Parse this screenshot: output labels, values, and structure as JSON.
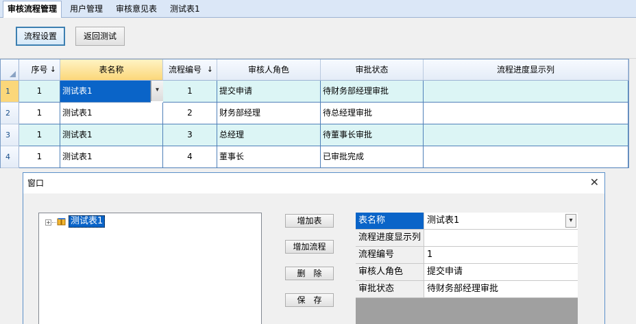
{
  "tabs": [
    {
      "label": "审核流程管理"
    },
    {
      "label": "用户管理"
    },
    {
      "label": "审核意见表"
    },
    {
      "label": "测试表1"
    }
  ],
  "toolbar": {
    "flow_settings_label": "流程设置",
    "back_test_label": "返回测试"
  },
  "grid": {
    "columns": [
      "序号",
      "表名称",
      "流程编号",
      "审核人角色",
      "审批状态",
      "流程进度显示列"
    ],
    "sort_glyph": "↓",
    "rows": [
      {
        "rownum": "1",
        "seq": "1",
        "table": "测试表1",
        "flow_no": "1",
        "role": "提交申请",
        "status": "待财务部经理审批",
        "progress": ""
      },
      {
        "rownum": "2",
        "seq": "1",
        "table": "测试表1",
        "flow_no": "2",
        "role": "财务部经理",
        "status": "待总经理审批",
        "progress": ""
      },
      {
        "rownum": "3",
        "seq": "1",
        "table": "测试表1",
        "flow_no": "3",
        "role": "总经理",
        "status": "待董事长审批",
        "progress": ""
      },
      {
        "rownum": "4",
        "seq": "1",
        "table": "测试表1",
        "flow_no": "4",
        "role": "董事长",
        "status": "已审批完成",
        "progress": ""
      }
    ],
    "row_colors": {
      "alt": "#dcf5f5",
      "plain": "#ffffff"
    }
  },
  "window": {
    "title": "窗口",
    "close_glyph": "✕",
    "tree": {
      "expander": "+",
      "node_label": "测试表1",
      "node_icon": "table-node-icon"
    },
    "buttons": {
      "add_table": "增加表",
      "add_flow": "增加流程",
      "delete": "删　除",
      "save": "保　存"
    },
    "props": [
      {
        "key": "表名称",
        "value": "测试表1"
      },
      {
        "key": "流程进度显示列",
        "value": ""
      },
      {
        "key": "流程编号",
        "value": "1"
      },
      {
        "key": "审核人角色",
        "value": "提交申请"
      },
      {
        "key": "审批状态",
        "value": "待财务部经理审批"
      }
    ]
  }
}
